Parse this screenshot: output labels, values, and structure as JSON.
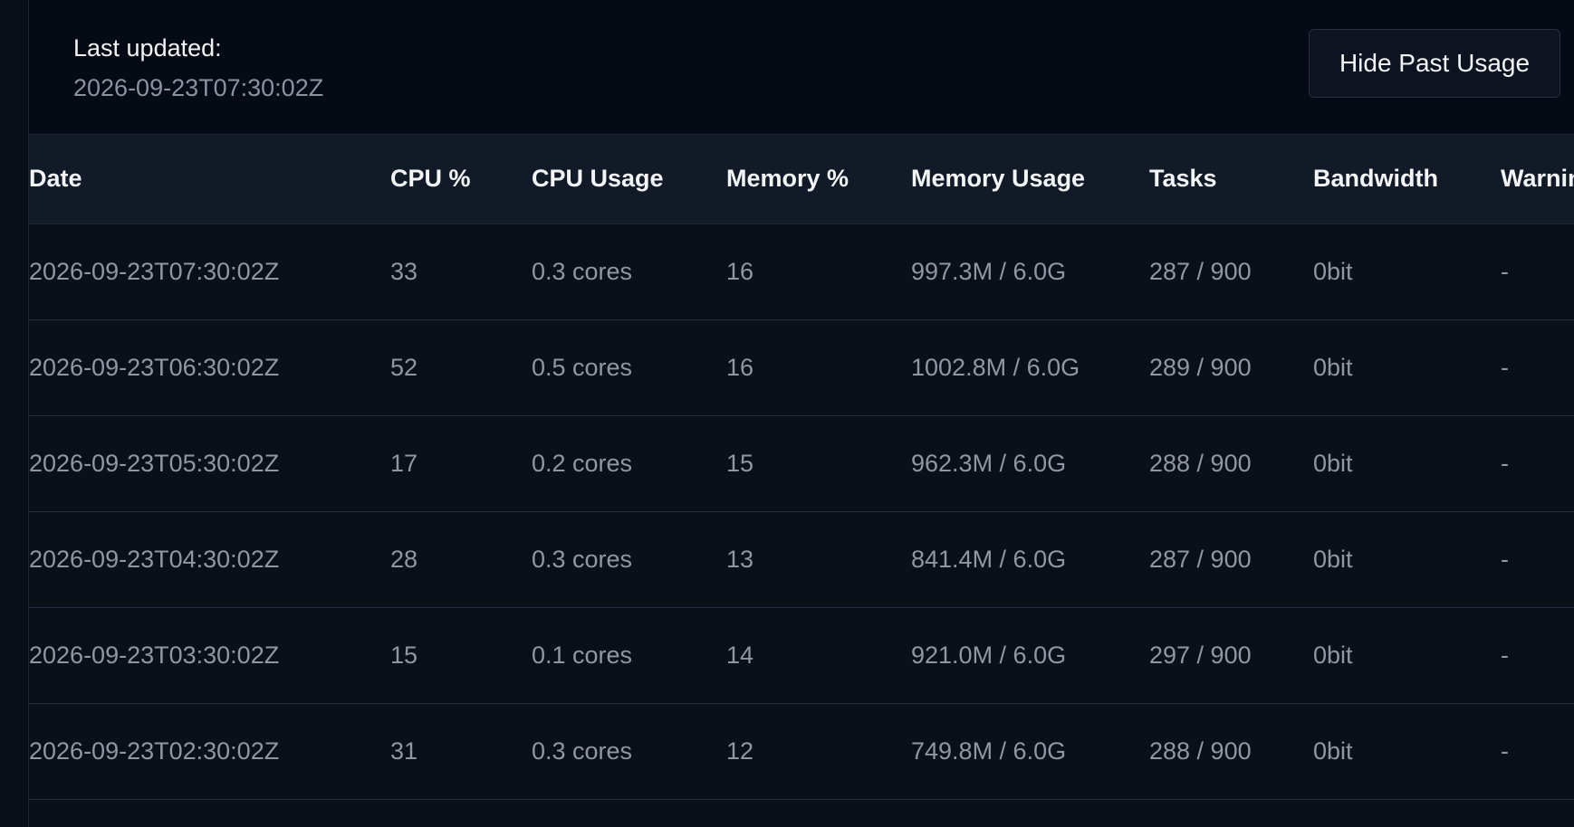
{
  "header": {
    "last_updated_label": "Last updated:",
    "last_updated_value": "2026-09-23T07:30:02Z",
    "hide_button_label": "Hide Past Usage"
  },
  "table": {
    "columns": [
      "Date",
      "CPU %",
      "CPU Usage",
      "Memory %",
      "Memory Usage",
      "Tasks",
      "Bandwidth",
      "Warnings"
    ],
    "rows": [
      {
        "date": "2026-09-23T07:30:02Z",
        "cpu_pct": "33",
        "cpu_usage": "0.3 cores",
        "mem_pct": "16",
        "mem_usage": "997.3M / 6.0G",
        "tasks": "287 / 900",
        "bandwidth": "0bit",
        "warnings": "-"
      },
      {
        "date": "2026-09-23T06:30:02Z",
        "cpu_pct": "52",
        "cpu_usage": "0.5 cores",
        "mem_pct": "16",
        "mem_usage": "1002.8M / 6.0G",
        "tasks": "289 / 900",
        "bandwidth": "0bit",
        "warnings": "-"
      },
      {
        "date": "2026-09-23T05:30:02Z",
        "cpu_pct": "17",
        "cpu_usage": "0.2 cores",
        "mem_pct": "15",
        "mem_usage": "962.3M / 6.0G",
        "tasks": "288 / 900",
        "bandwidth": "0bit",
        "warnings": "-"
      },
      {
        "date": "2026-09-23T04:30:02Z",
        "cpu_pct": "28",
        "cpu_usage": "0.3 cores",
        "mem_pct": "13",
        "mem_usage": "841.4M / 6.0G",
        "tasks": "287 / 900",
        "bandwidth": "0bit",
        "warnings": "-"
      },
      {
        "date": "2026-09-23T03:30:02Z",
        "cpu_pct": "15",
        "cpu_usage": "0.1 cores",
        "mem_pct": "14",
        "mem_usage": "921.0M / 6.0G",
        "tasks": "297 / 900",
        "bandwidth": "0bit",
        "warnings": "-"
      },
      {
        "date": "2026-09-23T02:30:02Z",
        "cpu_pct": "31",
        "cpu_usage": "0.3 cores",
        "mem_pct": "12",
        "mem_usage": "749.8M / 6.0G",
        "tasks": "288 / 900",
        "bandwidth": "0bit",
        "warnings": "-"
      }
    ]
  },
  "colors": {
    "background": "#0b0f17",
    "header_bar": "#050a14",
    "table_header": "#121a28",
    "text_primary": "#f3f4f6",
    "text_muted": "#9097a4",
    "border": "#243042"
  }
}
